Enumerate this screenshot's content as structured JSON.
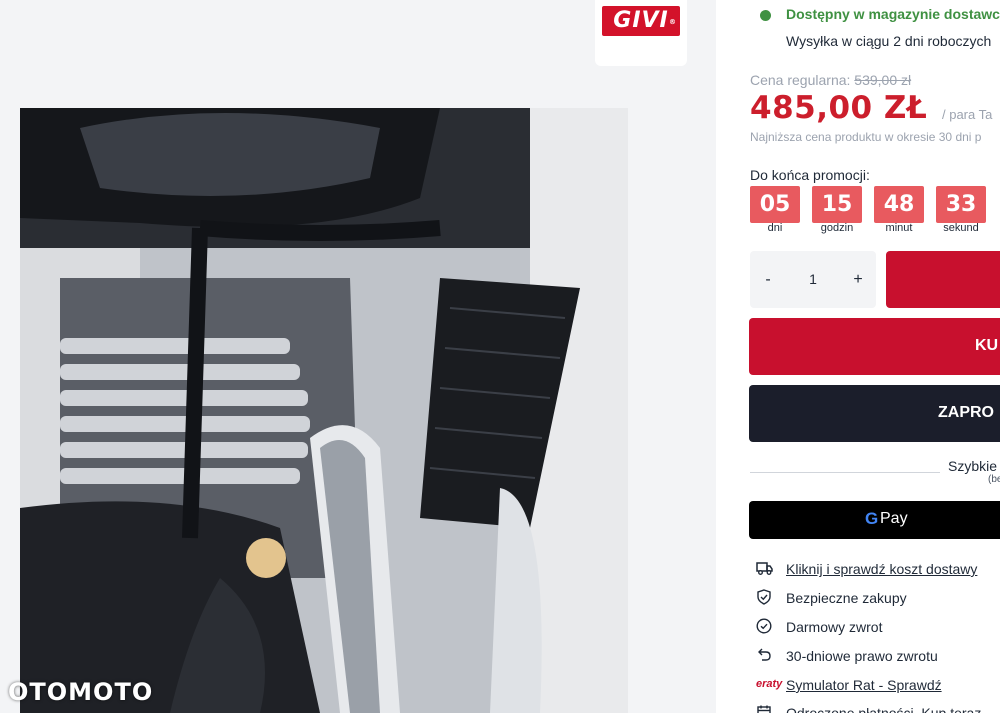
{
  "brand": {
    "logo_text": "GIVI",
    "logo_mark": "®"
  },
  "watermark": "OTOMOTO",
  "stock": {
    "status": "Dostępny w magazynie dostawcy",
    "shipping": "Wysyłka w ciągu 2 dni roboczych"
  },
  "price": {
    "regular_label": "Cena regularna:",
    "regular_value": "539,00 zł",
    "current": "485,00 ZŁ",
    "unit": "/ para",
    "unit_extra": "Ta",
    "lowest_note": "Najniższa cena produktu w okresie 30 dni p"
  },
  "promo": {
    "label": "Do końca promocji:",
    "timer": [
      {
        "value": "05",
        "label": "dni"
      },
      {
        "value": "15",
        "label": "godzin"
      },
      {
        "value": "48",
        "label": "minut"
      },
      {
        "value": "33",
        "label": "sekund"
      }
    ]
  },
  "quantity": {
    "minus": "-",
    "value": "1",
    "plus": "+"
  },
  "buttons": {
    "buy": "KU",
    "ask": "ZAPRO"
  },
  "quick_pay": {
    "label": "Szybkie",
    "sub": "(be"
  },
  "gpay": {
    "g": "G",
    "label": "Pay"
  },
  "benefits": [
    {
      "icon": "truck-icon",
      "text": "Kliknij i sprawdź koszt dostawy",
      "link": true
    },
    {
      "icon": "shield-check-icon",
      "text": "Bezpieczne zakupy",
      "link": false
    },
    {
      "icon": "check-circle-icon",
      "text": "Darmowy zwrot",
      "link": false
    },
    {
      "icon": "return-arrow-icon",
      "text": "30-dniowe prawo zwrotu",
      "link": false
    },
    {
      "icon": "eraty-logo",
      "icon_text": "eraty",
      "text": "Symulator Rat - Sprawdź",
      "link": true
    },
    {
      "icon": "calendar-icon",
      "text": "Odroczone płatności. Kup teraz",
      "link": true
    }
  ],
  "colors": {
    "accent_red": "#c8102e",
    "timer_red": "#e85a5f",
    "stock_green": "#3f9142",
    "dark_button": "#1b1e2b"
  }
}
